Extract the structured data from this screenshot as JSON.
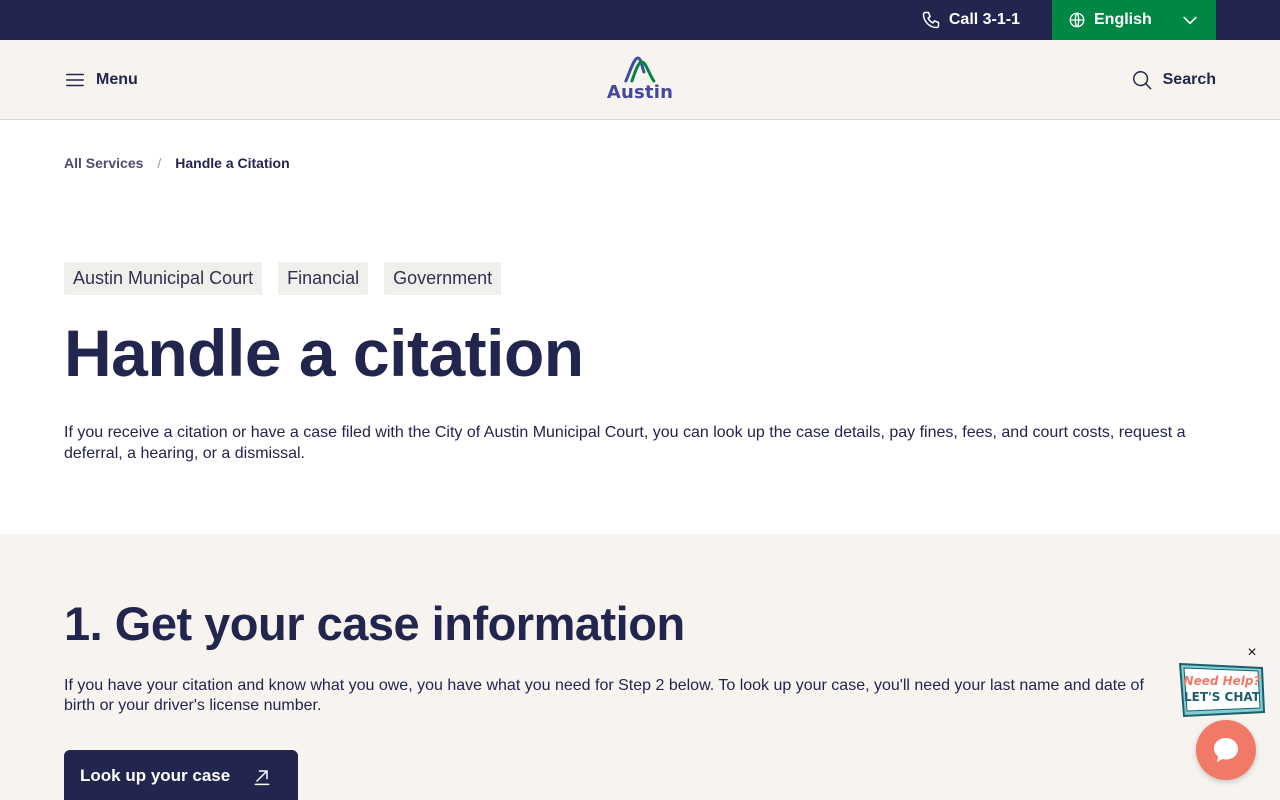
{
  "utility": {
    "call_label": "Call 3-1-1",
    "language_label": "English"
  },
  "header": {
    "menu_label": "Menu",
    "logo_text": "Austin",
    "search_label": "Search"
  },
  "breadcrumb": {
    "items": [
      "All Services",
      "Handle a Citation"
    ],
    "separator": "/"
  },
  "hero": {
    "tags": [
      "Austin Municipal Court",
      "Financial",
      "Government"
    ],
    "title": "Handle a citation",
    "intro": "If you receive a citation or have a case filed with the City of Austin Municipal Court, you can look up the case details, pay fines, fees, and court costs, request a deferral, a hearing, or a dismissal."
  },
  "step1": {
    "title": "1. Get your case information",
    "text": "If you have your citation and know what you owe, you have what you need for Step 2 below. To look up your case, you'll need your last name and date of birth or your driver's license number.",
    "button_label": "Look up your case"
  },
  "chat": {
    "close_label": "×",
    "sign_line1": "Need Help?",
    "sign_line2": "LET'S CHAT"
  },
  "colors": {
    "navy": "#22254e",
    "green": "#008743",
    "cream": "#f7f4f0",
    "chat": "#f07a67"
  }
}
